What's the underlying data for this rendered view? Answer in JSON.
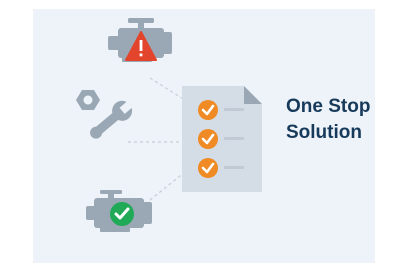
{
  "heading": {
    "line1": "One Stop",
    "line2": "Solution"
  },
  "icons": [
    {
      "name": "engine-warning-icon",
      "status_color": "#e2452c"
    },
    {
      "name": "wrench-nut-icon"
    },
    {
      "name": "checklist-document-icon",
      "check_color": "#f08a24",
      "items": 3
    },
    {
      "name": "engine-ok-icon",
      "status_color": "#20a957"
    }
  ],
  "colors": {
    "panel_bg": "#edf3f9",
    "icon_gray": "#9aa7b4",
    "heading_text": "#173a5a"
  }
}
